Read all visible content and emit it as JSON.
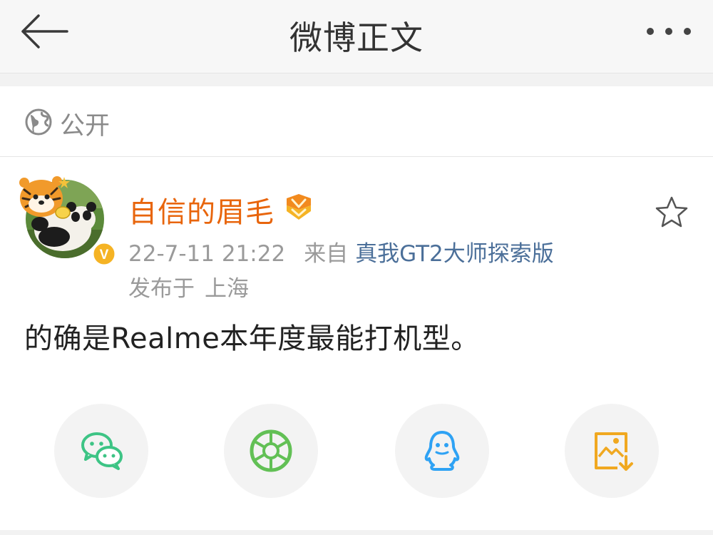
{
  "navbar": {
    "title": "微博正文",
    "back_icon": "arrow-left-icon",
    "more_icon": "more-horizontal-icon"
  },
  "post": {
    "visibility": "公开",
    "visibility_icon": "globe-icon",
    "author": {
      "name": "自信的眉毛",
      "verified_badge": "V",
      "avatar_icon": "avatar-panda-tiger"
    },
    "timestamp": "22-7-11 21:22",
    "source_prefix": "来自",
    "source_device": "真我GT2大师探索版",
    "location_prefix": "发布于",
    "location": "上海",
    "text": "的确是Realme本年度最能打机型。"
  },
  "share": {
    "items": [
      {
        "icon": "wechat-icon",
        "color": "#3dc485"
      },
      {
        "icon": "moments-shutter-icon",
        "color": "#62c055"
      },
      {
        "icon": "qq-penguin-icon",
        "color": "#2ea2f4"
      },
      {
        "icon": "save-image-icon",
        "color": "#f0a820"
      }
    ]
  },
  "colors": {
    "username": "#e8650c",
    "device_link": "#4b6f99",
    "meta_gray": "#9a9a9a"
  }
}
